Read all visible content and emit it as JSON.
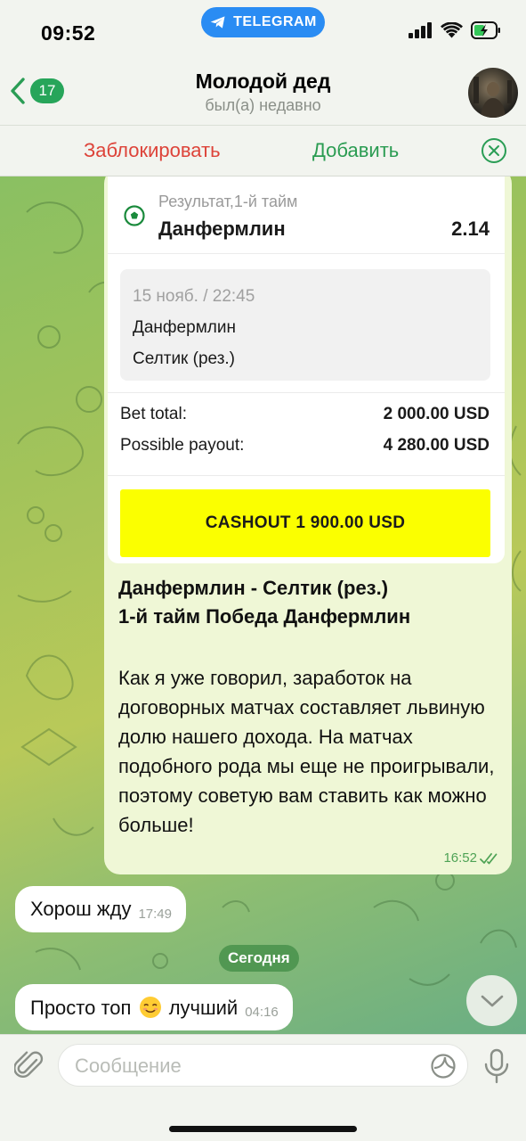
{
  "status_bar": {
    "time": "09:52",
    "telegram_label": "TELEGRAM"
  },
  "header": {
    "back_count": "17",
    "title": "Молодой дед",
    "subtitle": "был(а) недавно"
  },
  "action_bar": {
    "block_label": "Заблокировать",
    "add_label": "Добавить"
  },
  "bet_card": {
    "result_label": "Результат,1-й тайм",
    "team": "Данфермлин",
    "odds": "2.14",
    "match_date": "15 нояб. / 22:45",
    "team1": "Данфермлин",
    "team2": "Селтик (рез.)",
    "bet_total_label": "Bet total:",
    "bet_total_value": "2 000.00 USD",
    "payout_label": "Possible payout:",
    "payout_value": "4 280.00 USD",
    "cashout_label": "CASHOUT 1 900.00 USD"
  },
  "outgoing": {
    "headline_line1": "Данфермлин - Селтик (рез.)",
    "headline_line2": "1-й тайм Победа Данфермлин",
    "body": "Как я уже говорил, заработок на договорных матчах составляет львиную долю нашего дохода. На матчах подобного рода мы еще не проигрывали, поэтому советую вам ставить как можно больше!",
    "time": "16:52"
  },
  "incoming": [
    {
      "text": "Хорош жду",
      "time": "17:49"
    },
    {
      "text_before": "Просто топ",
      "emoji": "smiling-face-emoji",
      "text_after": "лучший",
      "time": "04:16"
    }
  ],
  "date_separator": "Сегодня",
  "input": {
    "placeholder": "Сообщение"
  },
  "colors": {
    "accent_green": "#27a55a",
    "block_red": "#dd4339",
    "telegram_blue": "#2a8cf3",
    "cashout_yellow": "#fbff00",
    "outgoing_bubble": "#eff7d6"
  }
}
